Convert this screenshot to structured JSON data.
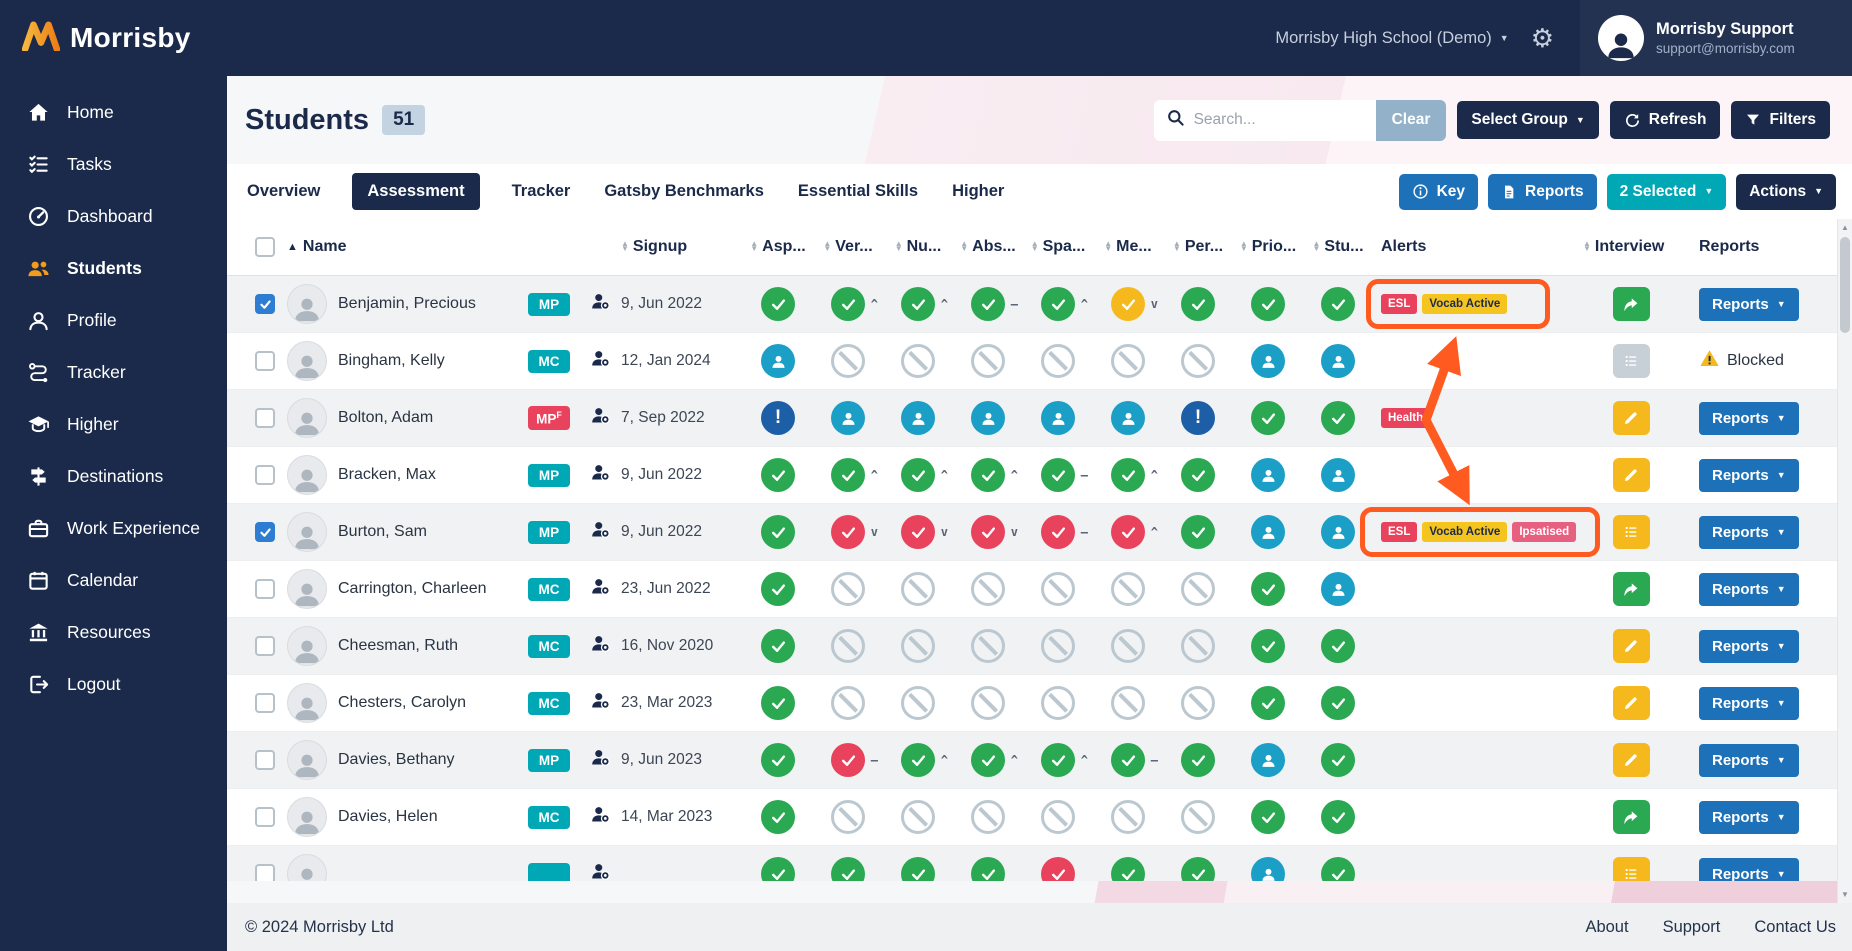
{
  "colors": {
    "navy": "#1b2a4a",
    "teal": "#00a7b5",
    "blue": "#1d71b8",
    "green": "#2aa952",
    "yellow": "#f5b91e",
    "red": "#e8425c",
    "annotation_orange": "#ff5a1f"
  },
  "topbar": {
    "school_selector": "Morrisby High School (Demo)",
    "user": {
      "name": "Morrisby Support",
      "email": "support@morrisby.com"
    }
  },
  "sidebar": {
    "logo_text": "Morrisby",
    "items": [
      {
        "label": "Home",
        "icon": "home",
        "active": false
      },
      {
        "label": "Tasks",
        "icon": "tasks",
        "active": false
      },
      {
        "label": "Dashboard",
        "icon": "dashboard",
        "active": false
      },
      {
        "label": "Students",
        "icon": "students",
        "active": true
      },
      {
        "label": "Profile",
        "icon": "profile",
        "active": false
      },
      {
        "label": "Tracker",
        "icon": "tracker",
        "active": false
      },
      {
        "label": "Higher",
        "icon": "higher",
        "active": false
      },
      {
        "label": "Destinations",
        "icon": "destinations",
        "active": false
      },
      {
        "label": "Work Experience",
        "icon": "briefcase",
        "active": false
      },
      {
        "label": "Calendar",
        "icon": "calendar",
        "active": false
      },
      {
        "label": "Resources",
        "icon": "resources",
        "active": false
      },
      {
        "label": "Logout",
        "icon": "logout",
        "active": false
      }
    ]
  },
  "page_header": {
    "title": "Students",
    "count_badge": "51",
    "search_placeholder": "Search...",
    "clear_button": "Clear",
    "select_group_button": "Select Group",
    "refresh_button": "Refresh",
    "filters_button": "Filters"
  },
  "tabs": {
    "items": [
      {
        "label": "Overview",
        "active": false
      },
      {
        "label": "Assessment",
        "active": true
      },
      {
        "label": "Tracker",
        "active": false
      },
      {
        "label": "Gatsby Benchmarks",
        "active": false
      },
      {
        "label": "Essential Skills",
        "active": false
      },
      {
        "label": "Higher",
        "active": false
      }
    ],
    "key_button": "Key",
    "reports_button": "Reports",
    "selected_button": "2 Selected",
    "actions_button": "Actions"
  },
  "table": {
    "columns": [
      {
        "label": "Name",
        "sort": "active-asc"
      },
      {
        "label": "Signup",
        "sort": "both"
      },
      {
        "label": "Asp...",
        "sort": "both"
      },
      {
        "label": "Ver...",
        "sort": "both"
      },
      {
        "label": "Nu...",
        "sort": "both"
      },
      {
        "label": "Abs...",
        "sort": "both"
      },
      {
        "label": "Spa...",
        "sort": "both"
      },
      {
        "label": "Me...",
        "sort": "both"
      },
      {
        "label": "Per...",
        "sort": "both"
      },
      {
        "label": "Prio...",
        "sort": "both"
      },
      {
        "label": "Stu...",
        "sort": "both"
      },
      {
        "label": "Alerts",
        "sort": "none"
      },
      {
        "label": "Interview",
        "sort": "both"
      },
      {
        "label": "Reports",
        "sort": "none"
      }
    ],
    "reports_button_label": "Reports",
    "blocked_label": "Blocked",
    "rows": [
      {
        "name": "Benjamin, Precious",
        "checked": true,
        "badge": {
          "text": "MP",
          "color": "teal"
        },
        "signup": "9, Jun 2022",
        "assessments": [
          {
            "icon": "check-green"
          },
          {
            "icon": "check-green",
            "trend": "up"
          },
          {
            "icon": "check-green",
            "trend": "up"
          },
          {
            "icon": "check-green",
            "trend": "flat"
          },
          {
            "icon": "check-green",
            "trend": "up"
          },
          {
            "icon": "check-yellow",
            "trend": "down"
          },
          {
            "icon": "check-green"
          },
          {
            "icon": "check-green"
          },
          {
            "icon": "check-green"
          }
        ],
        "alerts": [
          {
            "text": "ESL",
            "color": "red"
          },
          {
            "text": "Vocab Active",
            "color": "yellow"
          }
        ],
        "alerts_highlighted": true,
        "interview": "forward-green",
        "reports": "button"
      },
      {
        "name": "Bingham, Kelly",
        "checked": false,
        "badge": {
          "text": "MC",
          "color": "teal"
        },
        "signup": "12, Jan 2024",
        "assessments": [
          {
            "icon": "profile-person"
          },
          {
            "icon": "not-started"
          },
          {
            "icon": "not-started"
          },
          {
            "icon": "not-started"
          },
          {
            "icon": "not-started"
          },
          {
            "icon": "not-started"
          },
          {
            "icon": "not-started"
          },
          {
            "icon": "profile-person"
          },
          {
            "icon": "profile-person"
          }
        ],
        "alerts": [],
        "alerts_highlighted": false,
        "interview": "list-gray",
        "reports": "blocked"
      },
      {
        "name": "Bolton, Adam",
        "checked": false,
        "badge": {
          "text": "MP",
          "sup": "F",
          "color": "red"
        },
        "signup": "7, Sep 2022",
        "assessments": [
          {
            "icon": "attention"
          },
          {
            "icon": "profile-person"
          },
          {
            "icon": "profile-person"
          },
          {
            "icon": "profile-person"
          },
          {
            "icon": "profile-person"
          },
          {
            "icon": "profile-person"
          },
          {
            "icon": "attention"
          },
          {
            "icon": "check-green"
          },
          {
            "icon": "check-green"
          }
        ],
        "alerts": [
          {
            "text": "Health",
            "color": "red"
          }
        ],
        "alerts_highlighted": false,
        "interview": "pencil-yellow",
        "reports": "button"
      },
      {
        "name": "Bracken, Max",
        "checked": false,
        "badge": {
          "text": "MP",
          "color": "teal"
        },
        "signup": "9, Jun 2022",
        "assessments": [
          {
            "icon": "check-green"
          },
          {
            "icon": "check-green",
            "trend": "up"
          },
          {
            "icon": "check-green",
            "trend": "up"
          },
          {
            "icon": "check-green",
            "trend": "up"
          },
          {
            "icon": "check-green",
            "trend": "flat"
          },
          {
            "icon": "check-green",
            "trend": "up"
          },
          {
            "icon": "check-green"
          },
          {
            "icon": "profile-person"
          },
          {
            "icon": "profile-person"
          }
        ],
        "alerts": [],
        "alerts_highlighted": false,
        "interview": "pencil-yellow",
        "reports": "button"
      },
      {
        "name": "Burton, Sam",
        "checked": true,
        "badge": {
          "text": "MP",
          "color": "teal"
        },
        "signup": "9, Jun 2022",
        "assessments": [
          {
            "icon": "check-green"
          },
          {
            "icon": "check-red",
            "trend": "down"
          },
          {
            "icon": "check-red",
            "trend": "down"
          },
          {
            "icon": "check-red",
            "trend": "down"
          },
          {
            "icon": "check-red",
            "trend": "flat"
          },
          {
            "icon": "check-red",
            "trend": "up"
          },
          {
            "icon": "check-green"
          },
          {
            "icon": "profile-person"
          },
          {
            "icon": "profile-person"
          }
        ],
        "alerts": [
          {
            "text": "ESL",
            "color": "red"
          },
          {
            "text": "Vocab Active",
            "color": "yellow"
          },
          {
            "text": "Ipsatised",
            "color": "pink"
          }
        ],
        "alerts_highlighted": true,
        "interview": "list-yellow",
        "reports": "button"
      },
      {
        "name": "Carrington, Charleen",
        "checked": false,
        "badge": {
          "text": "MC",
          "color": "teal"
        },
        "signup": "23, Jun 2022",
        "assessments": [
          {
            "icon": "check-green"
          },
          {
            "icon": "not-started"
          },
          {
            "icon": "not-started"
          },
          {
            "icon": "not-started"
          },
          {
            "icon": "not-started"
          },
          {
            "icon": "not-started"
          },
          {
            "icon": "not-started"
          },
          {
            "icon": "check-green"
          },
          {
            "icon": "profile-person"
          }
        ],
        "alerts": [],
        "alerts_highlighted": false,
        "interview": "forward-green",
        "reports": "button"
      },
      {
        "name": "Cheesman, Ruth",
        "checked": false,
        "badge": {
          "text": "MC",
          "color": "teal"
        },
        "signup": "16, Nov 2020",
        "assessments": [
          {
            "icon": "check-green"
          },
          {
            "icon": "not-started"
          },
          {
            "icon": "not-started"
          },
          {
            "icon": "not-started"
          },
          {
            "icon": "not-started"
          },
          {
            "icon": "not-started"
          },
          {
            "icon": "not-started"
          },
          {
            "icon": "check-green"
          },
          {
            "icon": "check-green"
          }
        ],
        "alerts": [],
        "alerts_highlighted": false,
        "interview": "pencil-yellow",
        "reports": "button"
      },
      {
        "name": "Chesters, Carolyn",
        "checked": false,
        "badge": {
          "text": "MC",
          "color": "teal"
        },
        "signup": "23, Mar 2023",
        "assessments": [
          {
            "icon": "check-green"
          },
          {
            "icon": "not-started"
          },
          {
            "icon": "not-started"
          },
          {
            "icon": "not-started"
          },
          {
            "icon": "not-started"
          },
          {
            "icon": "not-started"
          },
          {
            "icon": "not-started"
          },
          {
            "icon": "check-green"
          },
          {
            "icon": "check-green"
          }
        ],
        "alerts": [],
        "alerts_highlighted": false,
        "interview": "pencil-yellow",
        "reports": "button"
      },
      {
        "name": "Davies, Bethany",
        "checked": false,
        "badge": {
          "text": "MP",
          "color": "teal"
        },
        "signup": "9, Jun 2023",
        "assessments": [
          {
            "icon": "check-green"
          },
          {
            "icon": "check-red",
            "trend": "flat"
          },
          {
            "icon": "check-green",
            "trend": "up"
          },
          {
            "icon": "check-green",
            "trend": "up"
          },
          {
            "icon": "check-green",
            "trend": "up"
          },
          {
            "icon": "check-green",
            "trend": "flat"
          },
          {
            "icon": "check-green"
          },
          {
            "icon": "profile-person"
          },
          {
            "icon": "check-green"
          }
        ],
        "alerts": [],
        "alerts_highlighted": false,
        "interview": "pencil-yellow",
        "reports": "button"
      },
      {
        "name": "Davies, Helen",
        "checked": false,
        "badge": {
          "text": "MC",
          "color": "teal"
        },
        "signup": "14, Mar 2023",
        "assessments": [
          {
            "icon": "check-green"
          },
          {
            "icon": "not-started"
          },
          {
            "icon": "not-started"
          },
          {
            "icon": "not-started"
          },
          {
            "icon": "not-started"
          },
          {
            "icon": "not-started"
          },
          {
            "icon": "not-started"
          },
          {
            "icon": "check-green"
          },
          {
            "icon": "check-green"
          }
        ],
        "alerts": [],
        "alerts_highlighted": false,
        "interview": "forward-green",
        "reports": "button"
      },
      {
        "name": "",
        "partial": true,
        "checked": false,
        "badge": {
          "text": "",
          "color": "teal"
        },
        "signup": "",
        "assessments": [
          {
            "icon": "check-green"
          },
          {
            "icon": "check-green"
          },
          {
            "icon": "check-green"
          },
          {
            "icon": "check-green"
          },
          {
            "icon": "check-red"
          },
          {
            "icon": "check-green"
          },
          {
            "icon": "check-green"
          },
          {
            "icon": "profile-person"
          },
          {
            "icon": "check-green"
          }
        ],
        "alerts": [],
        "alerts_highlighted": false,
        "interview": "list-yellow",
        "reports": "button"
      }
    ]
  },
  "annotation": {
    "color": "#ff5a1f",
    "highlighted_rows": [
      "Benjamin, Precious",
      "Burton, Sam"
    ]
  },
  "footer": {
    "copyright": "© 2024 Morrisby Ltd",
    "links": [
      "About",
      "Support",
      "Contact Us"
    ]
  }
}
